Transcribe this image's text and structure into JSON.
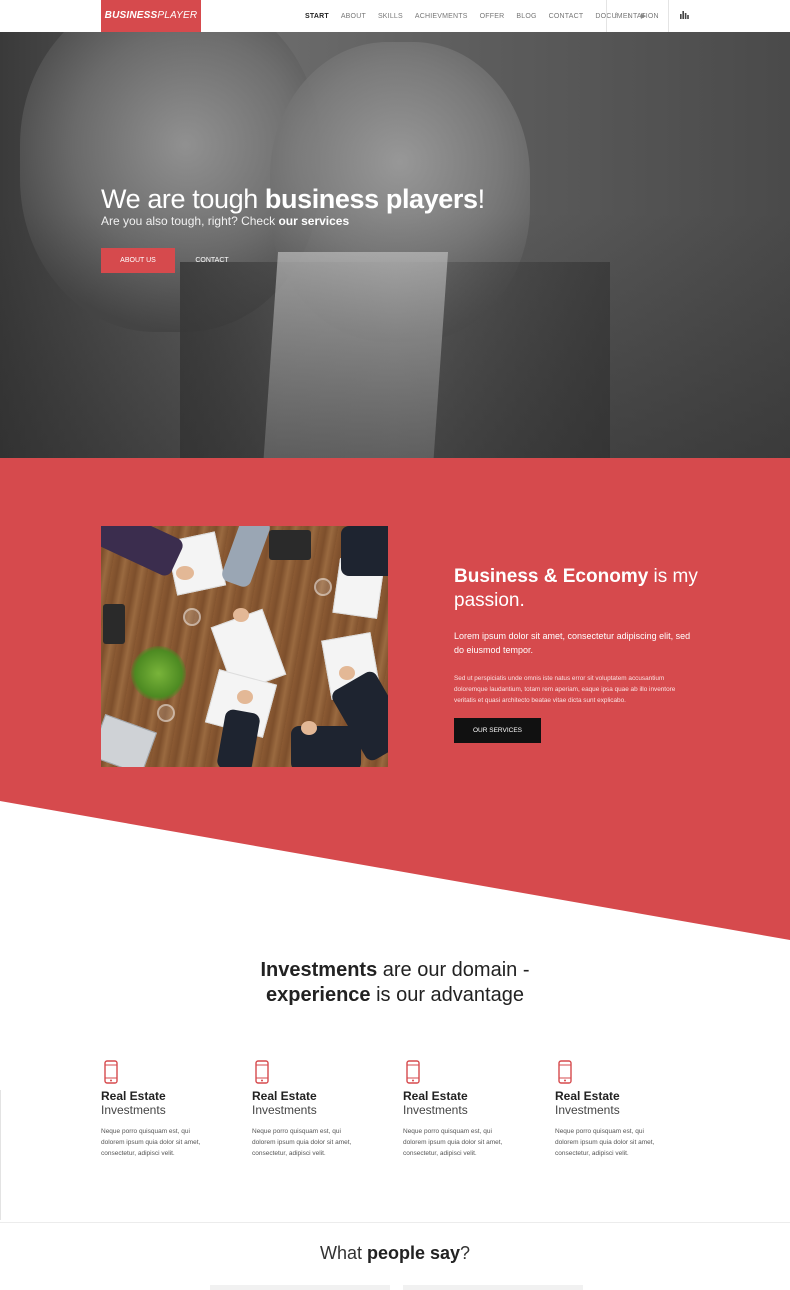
{
  "nav": {
    "logo_bold": "BUSINESS",
    "logo_light": "PLAYER",
    "items": [
      {
        "label": "START",
        "active": true
      },
      {
        "label": "ABOUT"
      },
      {
        "label": "SKILLS"
      },
      {
        "label": "ACHIEVMENTS"
      },
      {
        "label": "OFFER"
      },
      {
        "label": "BLOG"
      },
      {
        "label": "CONTACT"
      },
      {
        "label": "DOCUMENTATION"
      }
    ],
    "social": {
      "facebook": "f",
      "twitter": "t",
      "youtube": "▶"
    }
  },
  "hero": {
    "title_light": "We are tough ",
    "title_bold": "business players",
    "title_end": "!",
    "sub_light": "Are you also tough, right? Check ",
    "sub_bold": "our services",
    "btn_about": "ABOUT US",
    "btn_contact": "CONTACT"
  },
  "about": {
    "title_bold": "Business & Economy",
    "title_light": " is my passion.",
    "para1": "Lorem ipsum dolor sit amet, consectetur adipiscing elit, sed do eiusmod tempor.",
    "para2": "Sed ut perspiciatis unde omnis iste natus error sit voluptatem accusantium doloremque laudantium, totam rem aperiam, eaque ipsa quae ab illo inventore veritatis et quasi architecto beatae vitae dicta sunt explicabo.",
    "btn": "OUR SERVICES"
  },
  "investments": {
    "line1_bold": "Investments",
    "line1_light": " are our domain -",
    "line2_bold": "experience",
    "line2_light": " is our advantage",
    "features": [
      {
        "title": "Real Estate",
        "sub": "Investments",
        "desc": "Neque porro quisquam est, qui dolorem ipsum quia dolor sit amet, consectetur, adipisci velit."
      },
      {
        "title": "Real Estate",
        "sub": "Investments",
        "desc": "Neque porro quisquam est, qui dolorem ipsum quia dolor sit amet, consectetur, adipisci velit."
      },
      {
        "title": "Real Estate",
        "sub": "Investments",
        "desc": "Neque porro quisquam est, qui dolorem ipsum quia dolor sit amet, consectetur, adipisci velit."
      },
      {
        "title": "Real Estate",
        "sub": "Investments",
        "desc": "Neque porro quisquam est, qui dolorem ipsum quia dolor sit amet, consectetur, adipisci velit."
      }
    ]
  },
  "testimonials": {
    "light": "What ",
    "bold": "people say",
    "end": "?"
  },
  "colors": {
    "accent": "#d64a4d",
    "dark": "#111111",
    "white": "#ffffff"
  }
}
